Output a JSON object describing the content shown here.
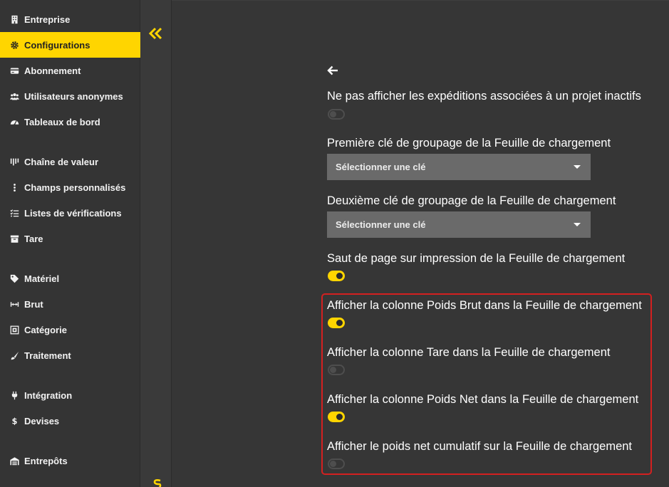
{
  "sidebar": {
    "items": [
      {
        "label": "Entreprise",
        "icon": "building-icon"
      },
      {
        "label": "Configurations",
        "icon": "gear-icon",
        "active": true
      },
      {
        "label": "Abonnement",
        "icon": "credit-card-icon"
      },
      {
        "label": "Utilisateurs anonymes",
        "icon": "users-icon"
      },
      {
        "label": "Tableaux de bord",
        "icon": "gauge-icon"
      },
      {
        "label": "Chaîne de valeur",
        "icon": "chain-icon"
      },
      {
        "label": "Champs personnalisés",
        "icon": "vertical-dots-icon"
      },
      {
        "label": "Listes de vérifications",
        "icon": "checklist-icon"
      },
      {
        "label": "Tare",
        "icon": "box-icon"
      },
      {
        "label": "Matériel",
        "icon": "tag-icon"
      },
      {
        "label": "Brut",
        "icon": "arrows-horizontal-icon"
      },
      {
        "label": "Catégorie",
        "icon": "category-icon"
      },
      {
        "label": "Traitement",
        "icon": "brush-icon"
      },
      {
        "label": "Intégration",
        "icon": "plug-icon"
      },
      {
        "label": "Devises",
        "icon": "dollar-icon"
      },
      {
        "label": "Entrepôts",
        "icon": "warehouse-icon"
      }
    ]
  },
  "accent_color": "#ffd500",
  "highlight_color": "#d42020",
  "settings": {
    "hide_inactive_project_shipments": {
      "label": "Ne pas afficher les expéditions associées à un projet inactifs",
      "enabled": false
    },
    "first_grouping_key": {
      "label": "Première clé de groupage de la Feuille de chargement",
      "placeholder": "Sélectionner une clé"
    },
    "second_grouping_key": {
      "label": "Deuxième clé de groupage de la Feuille de chargement",
      "placeholder": "Sélectionner une clé"
    },
    "page_break_on_print": {
      "label": "Saut de page sur impression de la Feuille de chargement",
      "enabled": true
    },
    "show_gross_weight_column": {
      "label": "Afficher la colonne Poids Brut dans la Feuille de chargement",
      "enabled": true
    },
    "show_tare_column": {
      "label": "Afficher la colonne Tare dans la Feuille de chargement",
      "enabled": false
    },
    "show_net_weight_column": {
      "label": "Afficher la colonne Poids Net dans la Feuille de chargement",
      "enabled": true
    },
    "show_cumulative_net_weight": {
      "label": "Afficher le poids net cumulatif sur la Feuille de chargement",
      "enabled": false
    }
  }
}
